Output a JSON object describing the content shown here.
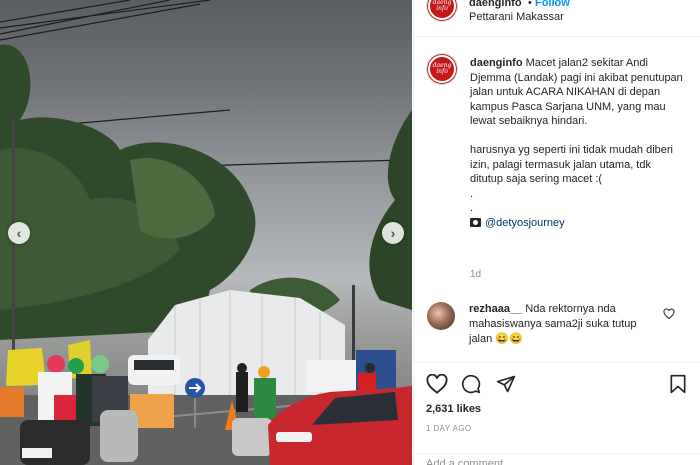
{
  "post": {
    "username": "daenginfo",
    "follow_label": "Follow",
    "separator": "•",
    "location": "Pettarani Makassar",
    "avatar_text_top": "daeng",
    "avatar_text_bottom": "info",
    "caption_text": " Macet jalan2 sekitar Andi Djemma (Landak) pagi ini akibat penutupan jalan untuk ACARA NIKAHAN di depan kampus Pasca Sarjana UNM, yang mau lewat sebaiknya hindari.\n\nharusnya yg seperti ini tidak mudah diberi izin, palagi termasuk jalan utama, tdk ditutup saja sering macet :(\n.\n.\n",
    "caption_mention": "@detyosjourney",
    "caption_time": "1d"
  },
  "comment": {
    "username": "rezhaaa__",
    "text": " Nda rektornya nda mahasiswanya sama2ji suka tutup jalan 😄😄"
  },
  "stats": {
    "likes": "2,631 likes",
    "date": "1 DAY AGO",
    "add_comment_placeholder": "Add a comment..."
  },
  "icons": {
    "like": "heart-icon",
    "comment": "comment-icon",
    "share": "share-icon",
    "save": "bookmark-icon",
    "camera": "camera-icon",
    "prev": "chevron-left-icon",
    "next": "chevron-right-icon",
    "prev_glyph": "‹",
    "next_glyph": "›"
  },
  "colors": {
    "brand_red": "#c21a1a",
    "follow_blue": "#0095f6",
    "text": "#262626",
    "muted": "#8e8e8e"
  }
}
